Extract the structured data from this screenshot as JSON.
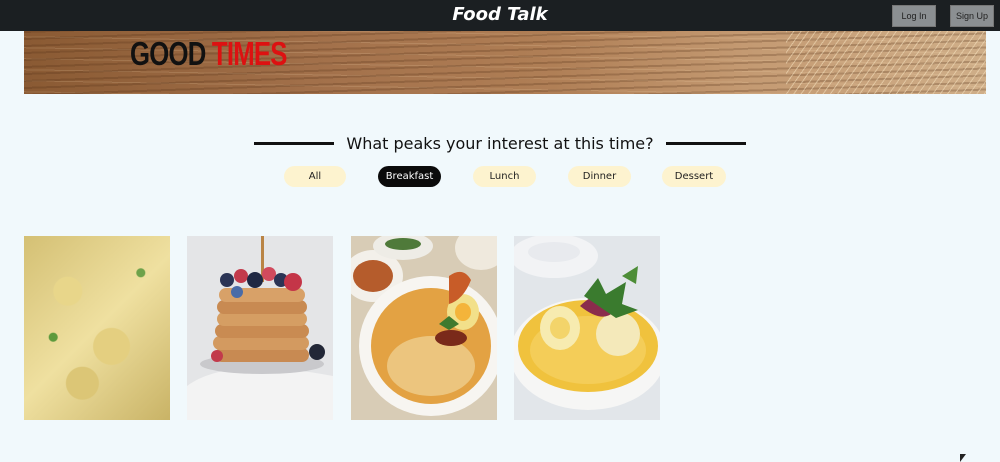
{
  "header": {
    "brand": "Food Talk",
    "login_label": "Log In",
    "signup_label": "Sign Up"
  },
  "banner": {
    "title_part1": "GOOD",
    "title_part2": "TIMES",
    "title_color1": "#111111",
    "title_color2": "#dd1111"
  },
  "section": {
    "prompt": "What peaks your interest at this time?"
  },
  "filters": {
    "active": "Breakfast",
    "items": [
      "All",
      "Breakfast",
      "Lunch",
      "Dinner",
      "Dessert"
    ]
  },
  "colors": {
    "header_bg": "#1b1f22",
    "page_bg": "#f1f9fc",
    "pill_bg": "#fdf3cf",
    "pill_active_bg": "#0b0b0b"
  },
  "gallery": {
    "images": [
      "scrambled-eggs-photo",
      "pancake-stack-photo",
      "noodle-soup-photo",
      "egg-curry-photo"
    ]
  }
}
